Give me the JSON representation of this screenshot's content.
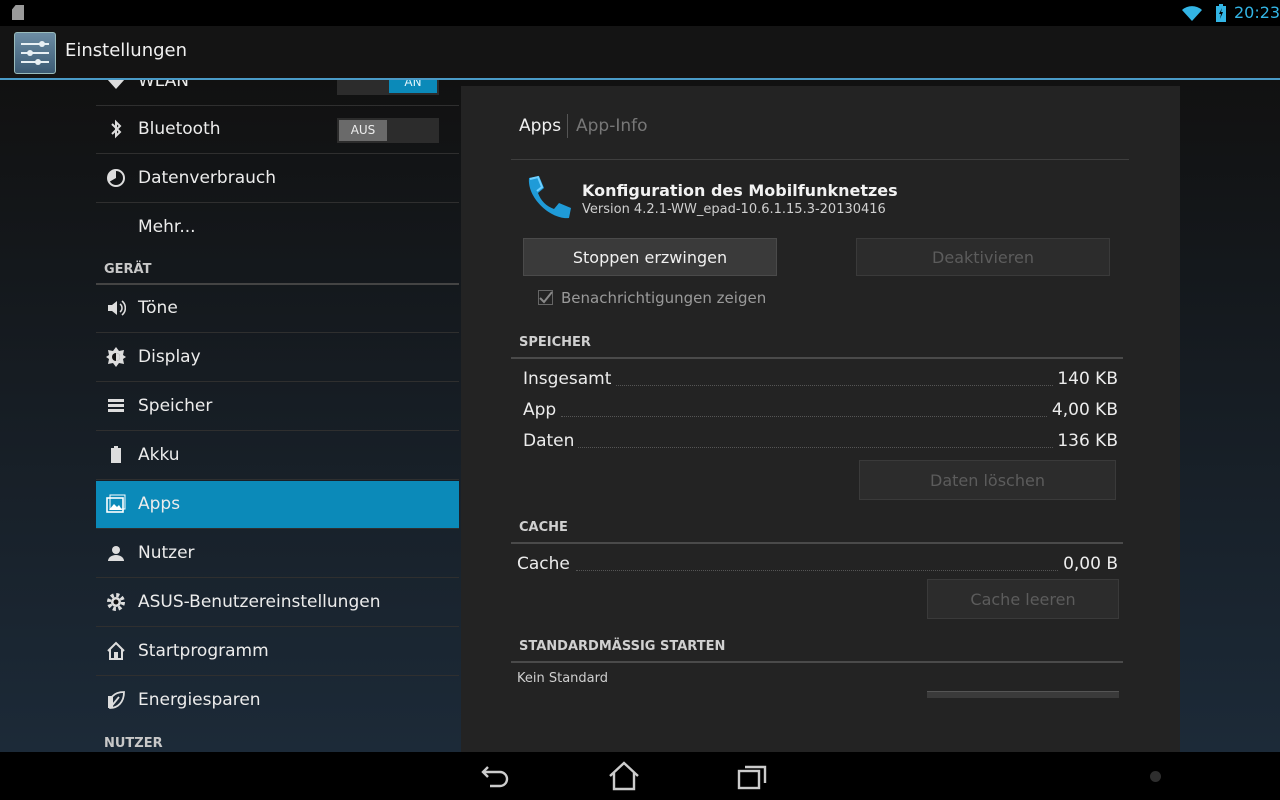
{
  "status_bar": {
    "time": "20:23",
    "icons": [
      "sd-card-icon",
      "wifi-icon",
      "battery-icon"
    ]
  },
  "action_bar": {
    "title": "Einstellungen",
    "icon": "settings-sliders-icon"
  },
  "sidebar": {
    "items": [
      {
        "label": "WLAN",
        "icon": "wifi-icon",
        "toggle": "AN"
      },
      {
        "label": "Bluetooth",
        "icon": "bluetooth-icon",
        "toggle": "AUS"
      },
      {
        "label": "Datenverbrauch",
        "icon": "data-usage-icon"
      },
      {
        "label": "Mehr...",
        "icon": ""
      },
      {
        "label": "Töne",
        "icon": "speaker-icon"
      },
      {
        "label": "Display",
        "icon": "brightness-icon"
      },
      {
        "label": "Speicher",
        "icon": "storage-icon"
      },
      {
        "label": "Akku",
        "icon": "battery-icon"
      },
      {
        "label": "Apps",
        "icon": "apps-icon",
        "selected": true
      },
      {
        "label": "Nutzer",
        "icon": "user-icon"
      },
      {
        "label": "ASUS-Benutzereinstellungen",
        "icon": "gear-icon"
      },
      {
        "label": "Startprogramm",
        "icon": "home-icon"
      },
      {
        "label": "Energiesparen",
        "icon": "leaf-icon"
      }
    ],
    "headers": {
      "device": "GERÄT",
      "users": "NUTZER"
    }
  },
  "detail": {
    "tabs": {
      "apps": "Apps",
      "app_info": "App-Info"
    },
    "app_name": "Konfiguration des Mobilfunknetzes",
    "app_version": "Version 4.2.1-WW_epad-10.6.1.15.3-20130416",
    "buttons": {
      "force_stop": "Stoppen erzwingen",
      "disable": "Deaktivieren"
    },
    "notifications_label": "Benachrichtigungen zeigen",
    "notifications_checked": true,
    "storage": {
      "header": "SPEICHER",
      "rows": [
        {
          "label": "Insgesamt",
          "value": "140 KB"
        },
        {
          "label": "App",
          "value": "4,00 KB"
        },
        {
          "label": "Daten",
          "value": "136 KB"
        }
      ],
      "clear_data": "Daten löschen"
    },
    "cache": {
      "header": "CACHE",
      "label": "Cache",
      "value": "0,00 B",
      "clear_cache": "Cache leeren"
    },
    "launch_default": {
      "header": "STANDARDMÄSSIG STARTEN",
      "text": "Kein Standard"
    }
  },
  "nav_bar": {
    "buttons": [
      "back-icon",
      "home-icon",
      "recent-apps-icon"
    ]
  }
}
